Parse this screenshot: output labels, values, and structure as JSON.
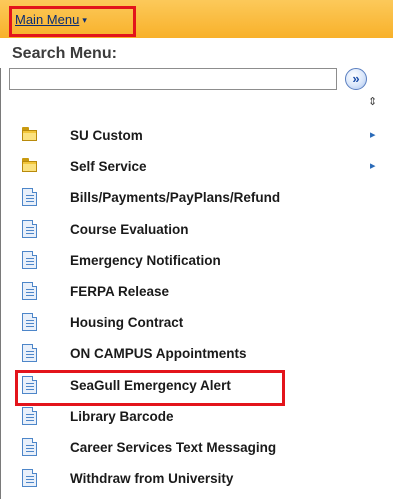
{
  "header": {
    "main_menu_label": "Main Menu",
    "main_menu_caret": "▾"
  },
  "search": {
    "label": "Search Menu:",
    "value": "",
    "placeholder": "",
    "go_glyph": "»"
  },
  "sort_glyph": "⇕",
  "menu_items": [
    {
      "label": "SU Custom",
      "icon": "folder-icon",
      "has_arrow": true
    },
    {
      "label": "Self Service",
      "icon": "folder-icon",
      "has_arrow": true
    },
    {
      "label": "Bills/Payments/PayPlans/Refund",
      "icon": "page-icon"
    },
    {
      "label": "Course Evaluation",
      "icon": "page-icon"
    },
    {
      "label": "Emergency Notification",
      "icon": "page-icon"
    },
    {
      "label": "FERPA Release",
      "icon": "page-icon"
    },
    {
      "label": "Housing Contract",
      "icon": "page-icon"
    },
    {
      "label": "ON CAMPUS Appointments",
      "icon": "page-icon"
    },
    {
      "label": "SeaGull Emergency Alert",
      "icon": "page-icon",
      "highlighted": true
    },
    {
      "label": "Library Barcode",
      "icon": "page-icon"
    },
    {
      "label": "Career Services Text Messaging",
      "icon": "page-icon"
    },
    {
      "label": "Withdraw from University",
      "icon": "page-icon"
    }
  ],
  "arrow_glyph": "▸",
  "colors": {
    "header_bar": "#f8b12a",
    "highlight_border": "#e3141b",
    "link": "#0a2d73",
    "folder": "#f2c63a",
    "page_icon": "#4d86c9"
  }
}
